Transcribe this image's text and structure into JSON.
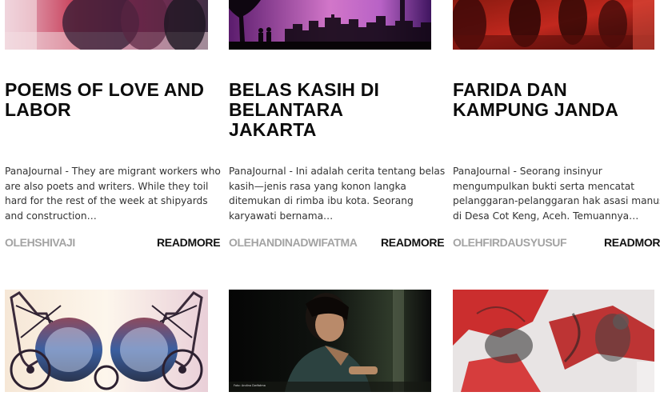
{
  "articles": [
    {
      "title_lines": [
        "POEMS OF LOVE AND",
        "LABOR"
      ],
      "excerpt_lines": [
        "PanaJournal - They are migrant workers who",
        "are also poets and writers. While they toil",
        "hard for the rest of the week at shipyards",
        "and construction…"
      ],
      "author": "OLEHSHIVAJI",
      "readmore": "READMORE"
    },
    {
      "title_lines": [
        "BELAS KASIH DI",
        "BELANTARA JAKARTA"
      ],
      "excerpt_lines": [
        "PanaJournal - Ini adalah cerita tentang belas",
        "kasih—jenis rasa yang konon langka",
        "ditemukan di rimba ibu kota. Seorang",
        "karyawati bernama…"
      ],
      "author": "OLEHANDINADWIFATMA",
      "readmore": "READMORE"
    },
    {
      "title_lines": [
        "FARIDA DAN",
        "KAMPUNG JANDA"
      ],
      "excerpt_lines": [
        "PanaJournal - Seorang insinyur",
        "mengumpulkan bukti serta mencatat",
        "pelanggaran-pelanggaran hak asasi manusia",
        "di Desa Cot Keng, Aceh. Temuannya…"
      ],
      "author": "OLEHFIRDAUSYUSUF",
      "readmore": "READMORE"
    }
  ],
  "photo_caption": "Foto: Andina Dwifatma"
}
